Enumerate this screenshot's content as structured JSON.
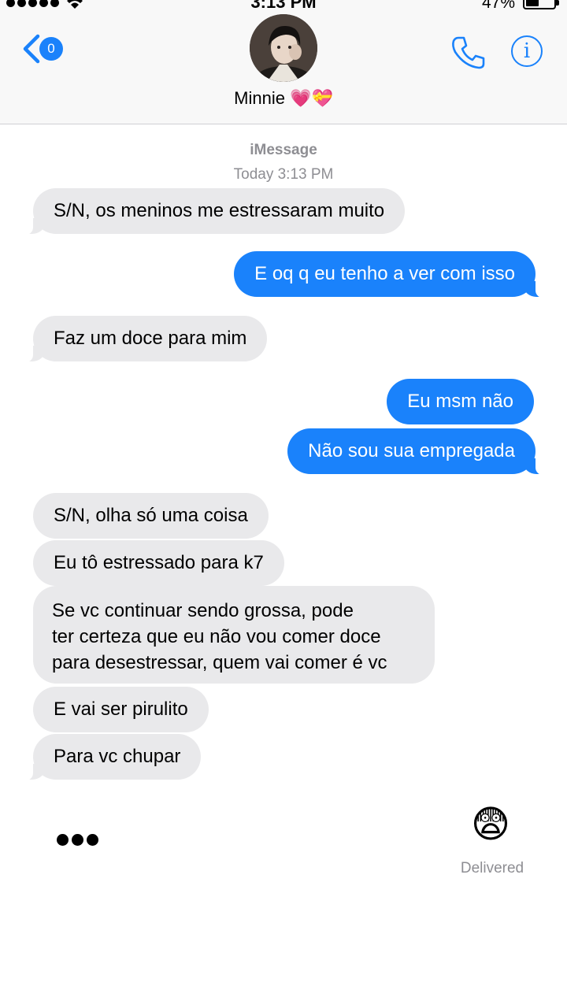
{
  "status_bar": {
    "time": "3:13 PM",
    "battery": "47%"
  },
  "header": {
    "back_count": "0",
    "contact_name": "Minnie 💗💝"
  },
  "thread": {
    "service": "iMessage",
    "timestamp": "Today 3:13 PM",
    "messages": [
      {
        "dir": "in",
        "text": "S/N, os meninos me estressaram muito"
      },
      {
        "dir": "out",
        "text": "E oq q eu tenho a ver com isso"
      },
      {
        "dir": "in",
        "text": "Faz um doce para mim"
      },
      {
        "dir": "out",
        "text": "Eu msm não"
      },
      {
        "dir": "out",
        "text": "Não sou sua empregada"
      },
      {
        "dir": "in",
        "text": "S/N, olha só uma coisa"
      },
      {
        "dir": "in",
        "text": "Eu tô estressado para k7"
      },
      {
        "dir": "in",
        "lines": [
          "Se vc continuar sendo grossa, pode",
          "ter certeza que eu não vou comer doce",
          "para desestressar, quem vai comer é vc"
        ]
      },
      {
        "dir": "in",
        "text": "E vai ser pirulito"
      },
      {
        "dir": "in",
        "text": "Para vc chupar"
      }
    ],
    "last_sent_emoji": "😨",
    "delivered_label": "Delivered"
  },
  "colors": {
    "accent": "#1a82fb",
    "incoming_bubble": "#e9e9eb",
    "meta_text": "#8e8e93"
  },
  "icons": [
    "back-chevron-icon",
    "phone-icon",
    "info-icon",
    "wifi-icon",
    "typing-indicator-icon"
  ]
}
